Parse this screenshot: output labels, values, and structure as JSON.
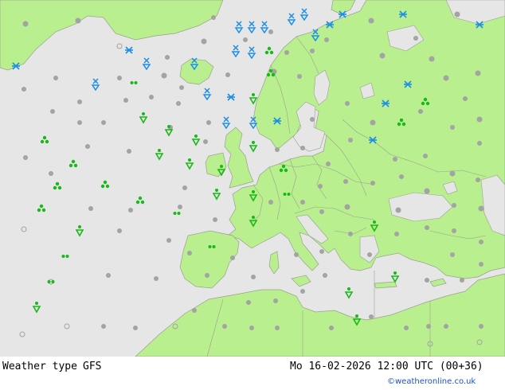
{
  "footer": {
    "title": "Weather type",
    "model": "GFS",
    "datetime": "Mo 16-02-2026 12:00 UTC (00+36)",
    "credit": "©weatheronline.co.uk"
  },
  "colors": {
    "sea": "#e6e6e6",
    "land": "#b9ef8f",
    "border": "#9aa08f",
    "cloud_dot": "#a3a3a3",
    "snow": "#1a8ee6",
    "rain": "#19b819"
  },
  "legend_symbols": [
    "cloudy-dot",
    "snow-symbol",
    "snow-shower-symbol",
    "rain-symbol",
    "rain-shower-symbol",
    "drizzle-symbol"
  ]
}
